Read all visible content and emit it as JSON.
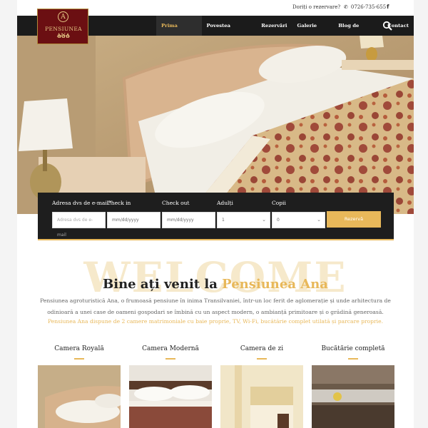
{
  "topbar": {
    "question": "Doriți o rezervare?",
    "phone": "0726-735-655",
    "facebook": "f"
  },
  "logo": {
    "name": "PENSIUNEA ANA",
    "initial": "A",
    "stars": "✿✿✿"
  },
  "nav": {
    "items": [
      {
        "label": "Prima pagină",
        "active": true
      },
      {
        "label": "Povestea noastră",
        "active": false
      },
      {
        "label": "Rezervări",
        "active": false
      },
      {
        "label": "Galerie foto",
        "active": false
      },
      {
        "label": "Blog de turism",
        "active": false
      },
      {
        "label": "Contact",
        "active": false
      }
    ]
  },
  "booking": {
    "email_label": "Adresa dvs de e-mail*",
    "email_placeholder": "Adresa dvs de e-mail",
    "checkin_label": "Check in",
    "checkin_value": "mm/dd/yyyy",
    "checkout_label": "Check out",
    "checkout_value": "mm/dd/yyyy",
    "adults_label": "Adulți",
    "adults_value": "1",
    "children_label": "Copii",
    "children_value": "0",
    "submit": "Rezervă"
  },
  "welcome": {
    "watermark": "WELCOME",
    "title_prefix": "Bine ați venit la ",
    "title_accent": "Pensiunea Ana",
    "description": "Pensiunea agroturistică Ana, o frumoasă pensiune în inima Transilvaniei, într-un loc ferit de aglomerație și unde arhitectura de odinioară a unei case de oameni gospodari se îmbină cu un aspect modern, o ambianță primitoare și o grădină generoasă.",
    "highlight": "Pensiunea Ana dispune de 2 camere matrimoniale cu baie proprie, TV, Wi-Fi, bucătărie complet utilată și parcare proprie."
  },
  "rooms": [
    {
      "title": "Camera Royală"
    },
    {
      "title": "Camera Modernă"
    },
    {
      "title": "Camera de zi"
    },
    {
      "title": "Bucătărie completă"
    }
  ],
  "colors": {
    "accent": "#e8b85a",
    "nav_bg": "#1b1b1b",
    "logo_bg": "#6b0f12"
  }
}
